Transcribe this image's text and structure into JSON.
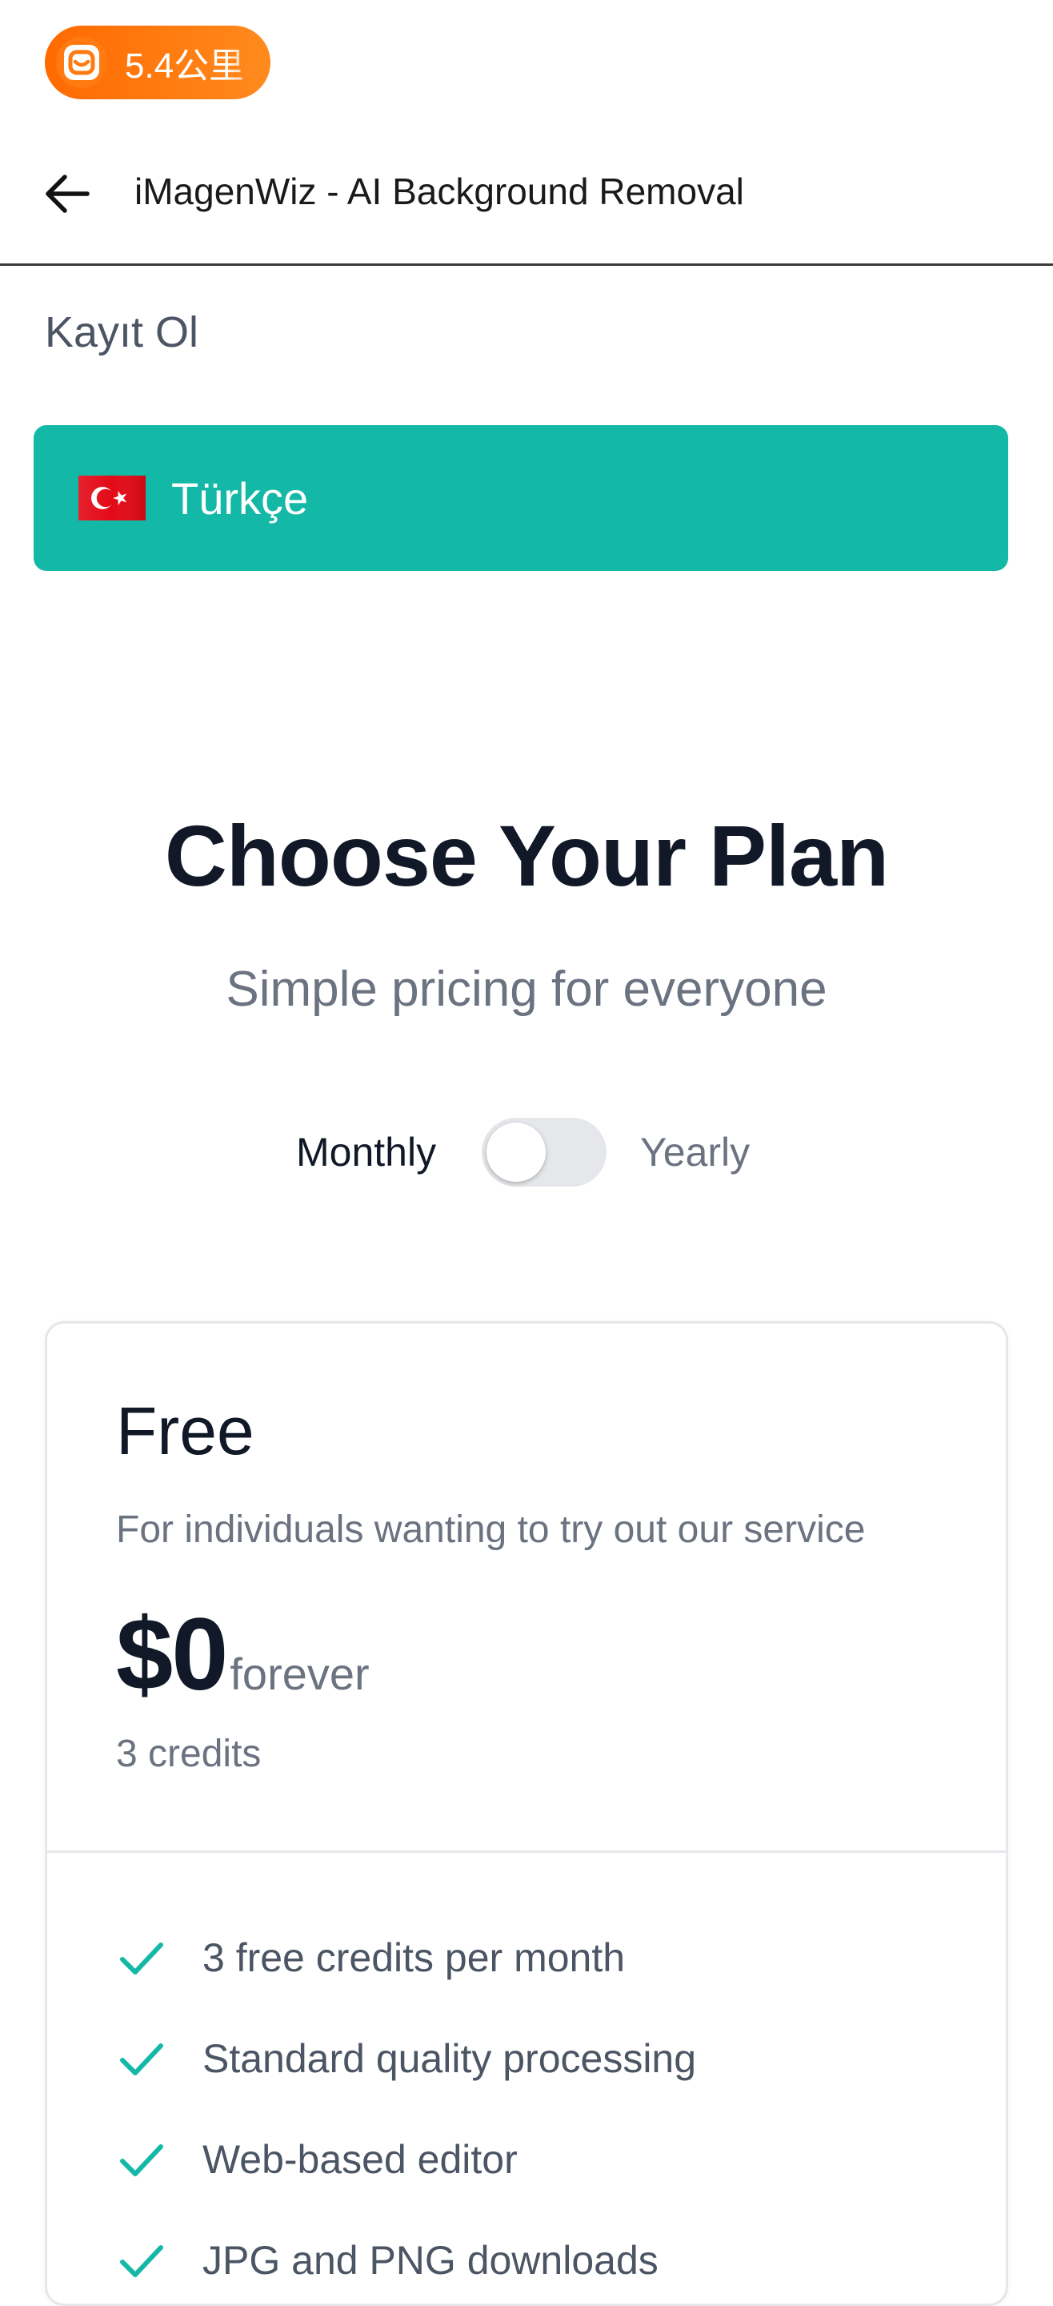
{
  "status": {
    "pill_text": "5.4公里",
    "pill_color": "#ff7a10"
  },
  "appbar": {
    "back_icon": "arrow-left-icon",
    "title": "iMagenWiz - AI Background Removal"
  },
  "auth": {
    "register_label": "Kayıt Ol"
  },
  "language": {
    "flag_icon": "turkey-flag-icon",
    "label": "Türkçe",
    "button_color": "#14b8a6"
  },
  "pricing": {
    "title": "Choose Your Plan",
    "subtitle": "Simple pricing for everyone",
    "billing": {
      "monthly_label": "Monthly",
      "yearly_label": "Yearly",
      "yearly_enabled": false
    },
    "plans": [
      {
        "name": "Free",
        "description": "For individuals wanting to try out our service",
        "price": "$0",
        "period": "forever",
        "credits": "3 credits",
        "features": [
          "3 free credits per month",
          "Standard quality processing",
          "Web-based editor",
          "JPG and PNG downloads"
        ]
      }
    ]
  },
  "colors": {
    "accent": "#14b8a6",
    "check": "#14b8a6",
    "heading": "#111827",
    "muted": "#6b7280"
  }
}
